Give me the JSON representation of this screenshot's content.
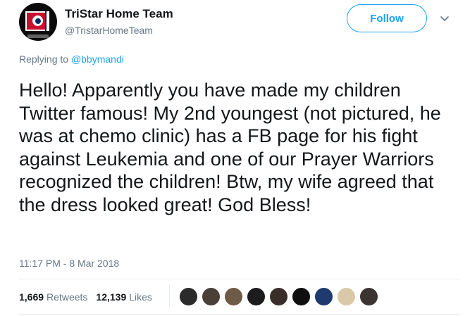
{
  "user": {
    "display_name": "TriStar Home Team",
    "handle": "@TristarHomeTeam"
  },
  "follow_label": "Follow",
  "reply": {
    "prefix": "Replying to",
    "mention": "@bbymandi"
  },
  "tweet_text": "Hello! Apparently you have made my children Twitter famous! My 2nd youngest (not pictured, he was at chemo clinic) has a FB page for his fight against Leukemia and one of our Prayer Warriors recognized the children! Btw, my wife agreed that the dress looked great! God Bless!",
  "timestamp": "11:17 PM - 8 Mar 2018",
  "stats": {
    "retweets_count": "1,669",
    "retweets_label": "Retweets",
    "likes_count": "12,139",
    "likes_label": "Likes"
  },
  "colors": {
    "accent": "#1da1f2",
    "muted": "#657786",
    "text": "#14171a"
  },
  "likers": [
    {
      "color": "#2b2b2b"
    },
    {
      "color": "#4a4038"
    },
    {
      "color": "#6d5a47"
    },
    {
      "color": "#1c1c1c"
    },
    {
      "color": "#3a2e2a"
    },
    {
      "color": "#0f0f0f"
    },
    {
      "color": "#1e3a6e"
    },
    {
      "color": "#d9c9a8"
    },
    {
      "color": "#3b3430"
    }
  ]
}
